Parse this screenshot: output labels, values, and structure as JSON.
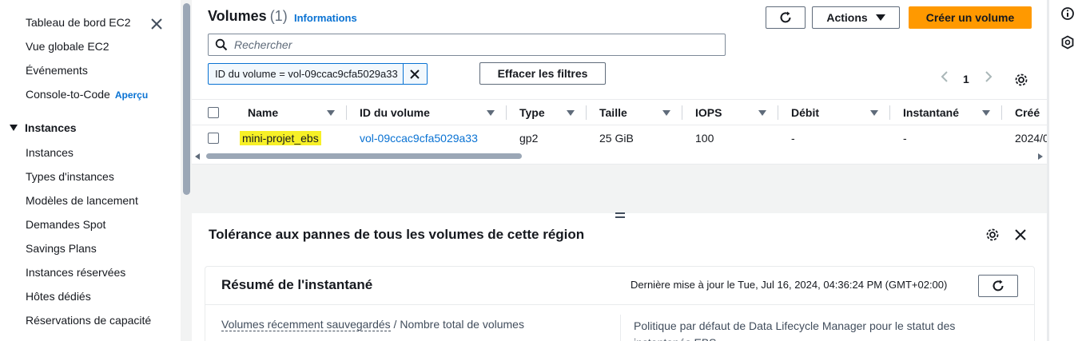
{
  "sidebar": {
    "items": [
      {
        "label": "Tableau de bord EC2"
      },
      {
        "label": "Vue globale EC2"
      },
      {
        "label": "Événements"
      },
      {
        "label": "Console-to-Code",
        "badge": "Aperçu"
      }
    ],
    "section": "Instances",
    "section_items": [
      {
        "label": "Instances"
      },
      {
        "label": "Types d'instances"
      },
      {
        "label": "Modèles de lancement"
      },
      {
        "label": "Demandes Spot"
      },
      {
        "label": "Savings Plans"
      },
      {
        "label": "Instances réservées"
      },
      {
        "label": "Hôtes dédiés"
      },
      {
        "label": "Réservations de capacité"
      }
    ]
  },
  "header": {
    "title": "Volumes",
    "count": "(1)",
    "info_link": "Informations",
    "actions_label": "Actions",
    "create_label": "Créer un volume"
  },
  "search": {
    "placeholder": "Rechercher",
    "value": ""
  },
  "filter": {
    "token": "ID du volume = vol-09ccac9cfa5029a33",
    "clear_label": "Effacer les filtres"
  },
  "pagination": {
    "page": "1"
  },
  "table": {
    "columns": [
      "Name",
      "ID du volume",
      "Type",
      "Taille",
      "IOPS",
      "Débit",
      "Instantané",
      "Créé"
    ],
    "rows": [
      {
        "name": "mini-projet_ebs",
        "volume_id": "vol-09ccac9cfa5029a33",
        "type": "gp2",
        "size": "25 GiB",
        "iops": "100",
        "throughput": "-",
        "snapshot": "-",
        "created": "2024/0"
      }
    ]
  },
  "panel": {
    "title": "Tolérance aux pannes de tous les volumes de cette région",
    "card": {
      "title": "Résumé de l'instantané",
      "updated": "Dernière mise à jour le Tue, Jul 16, 2024, 04:36:24 PM (GMT+02:00)",
      "left_link": "Volumes récemment sauvegardés",
      "left_rest": " / Nombre total de volumes",
      "right_text": "Politique par défaut de Data Lifecycle Manager pour le statut des instantanés EBS"
    }
  },
  "colors": {
    "accent": "#0972d3",
    "primary_button": "#ff9900",
    "highlight": "#f7f027"
  },
  "icons": [
    "close-icon",
    "refresh-icon",
    "caret-down-icon",
    "search-icon",
    "chevron-left-icon",
    "chevron-right-icon",
    "settings-icon",
    "sort-icon",
    "info-icon",
    "hexagon-icon"
  ]
}
